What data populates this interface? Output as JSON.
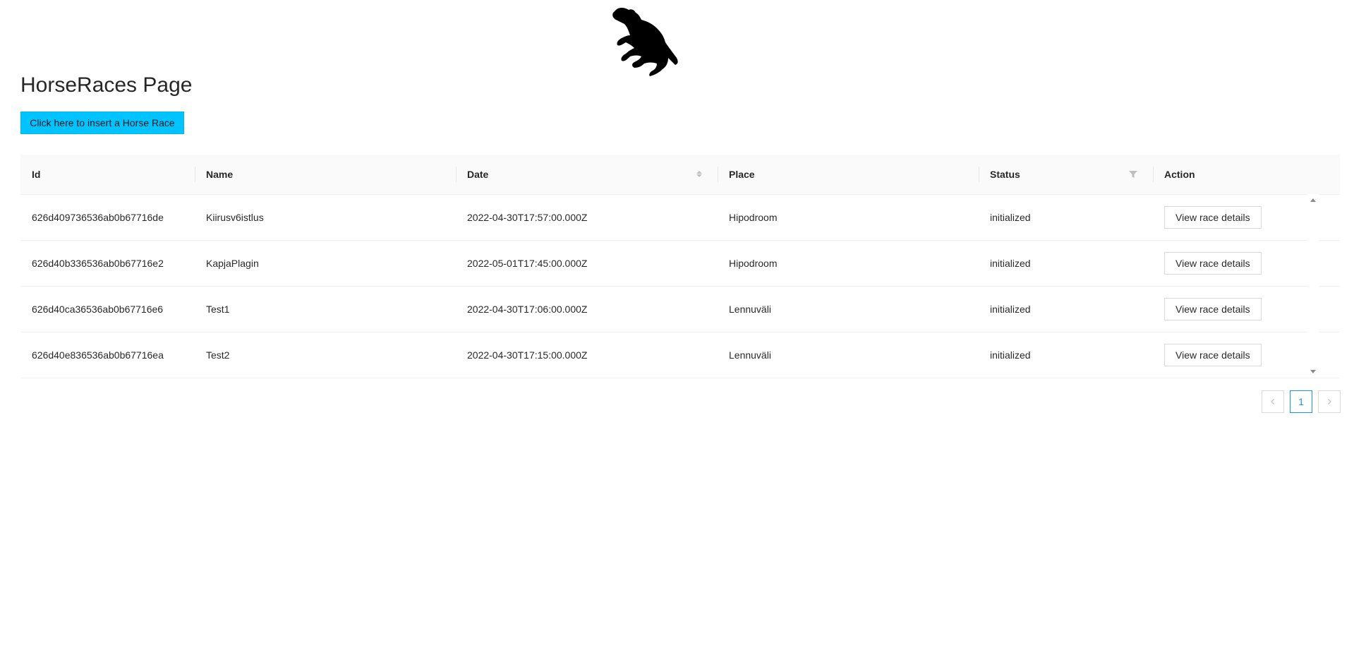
{
  "page": {
    "title": "HorseRaces Page",
    "insert_button_label": "Click here to insert a Horse Race",
    "logo_icon": "rearing-horse-icon"
  },
  "colors": {
    "insert_button_bg": "#00c3ff",
    "pagination_active": "#1890ff"
  },
  "table": {
    "columns": [
      {
        "label": "Id"
      },
      {
        "label": "Name"
      },
      {
        "label": "Date",
        "sortable": true
      },
      {
        "label": "Place"
      },
      {
        "label": "Status",
        "filterable": true
      },
      {
        "label": "Action"
      }
    ],
    "rows": [
      {
        "id": "626d409736536ab0b67716de",
        "name": "Kiirusv6istlus",
        "date": "2022-04-30T17:57:00.000Z",
        "place": "Hipodroom",
        "status": "initialized",
        "action": "View race details"
      },
      {
        "id": "626d40b336536ab0b67716e2",
        "name": "KapjaPlagin",
        "date": "2022-05-01T17:45:00.000Z",
        "place": "Hipodroom",
        "status": "initialized",
        "action": "View race details"
      },
      {
        "id": "626d40ca36536ab0b67716e6",
        "name": "Test1",
        "date": "2022-04-30T17:06:00.000Z",
        "place": "Lennuväli",
        "status": "initialized",
        "action": "View race details"
      },
      {
        "id": "626d40e836536ab0b67716ea",
        "name": "Test2",
        "date": "2022-04-30T17:15:00.000Z",
        "place": "Lennuväli",
        "status": "initialized",
        "action": "View race details"
      }
    ]
  },
  "pagination": {
    "prev_icon": "chevron-left-icon",
    "current_page": "1",
    "next_icon": "chevron-right-icon"
  }
}
